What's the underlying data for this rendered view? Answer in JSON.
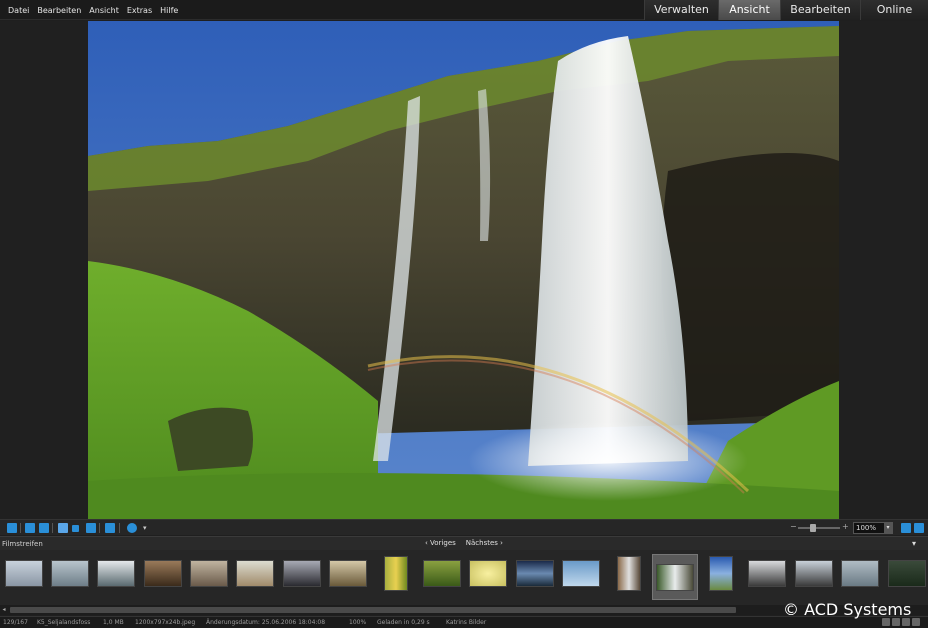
{
  "menu": {
    "items": [
      "Datei",
      "Bearbeiten",
      "Ansicht",
      "Extras",
      "Hilfe"
    ]
  },
  "modes": {
    "tabs": [
      {
        "label": "Verwalten",
        "active": false
      },
      {
        "label": "Ansicht",
        "active": true
      },
      {
        "label": "Bearbeiten",
        "active": false
      },
      {
        "label": "Online",
        "active": false
      }
    ]
  },
  "photo": {
    "subject": "Seljalandsfoss waterfall"
  },
  "toolbar": {
    "zoom_value": "100%",
    "zoom_minus": "−",
    "zoom_plus": "+"
  },
  "filmstrip": {
    "title": "Filmstreifen",
    "prev_label": "‹ Voriges",
    "next_label": "Nächstes ›",
    "collapse_icon": "▾"
  },
  "statusbar": {
    "position": "129/167",
    "filename": "K5_Seljalandsfoss",
    "filesize": "1,0 MB",
    "dimensions": "1200x797x24b.jpeg",
    "modified": "Änderungsdatum: 25.06.2006 18:04:08",
    "zoom": "100%",
    "loaded": "Geladen in 0,29 s",
    "folder": "Katrins Bilder"
  },
  "watermark": "© ACD Systems",
  "colors": {
    "active_tab": "#5a5a5a",
    "toolbar_icon": "#2a8fd8"
  }
}
